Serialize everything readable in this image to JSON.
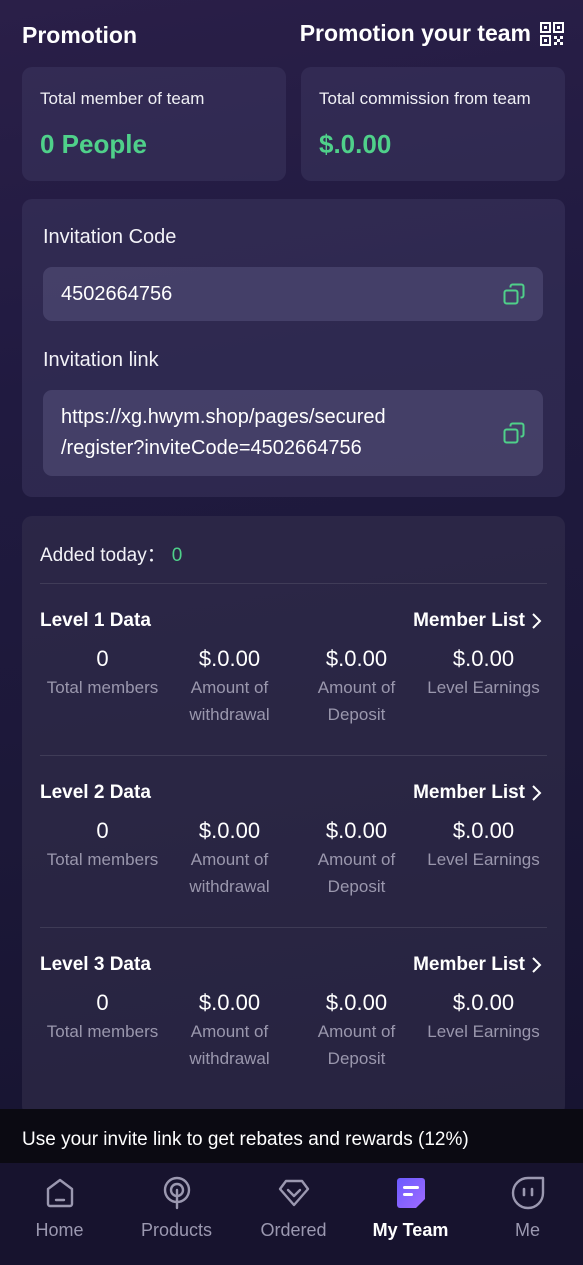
{
  "header": {
    "title": "Promotion",
    "promo_team_label": "Promotion your team",
    "promo_team_icon": "qr-code-icon"
  },
  "stats": {
    "members_label": "Total member of team",
    "members_value": "0 People",
    "commission_label": "Total commission from team",
    "commission_value": "$.0.00"
  },
  "invite": {
    "code_label": "Invitation Code",
    "code_value": "4502664756",
    "link_label": "Invitation link",
    "link_line1": "https://xg.hwym.shop/pages/secured",
    "link_line2": "/register?inviteCode=4502664756",
    "copy_icon": "copy-icon"
  },
  "team": {
    "added_label": "Added today：",
    "added_value": "0",
    "member_list_label": "Member List",
    "levels": [
      {
        "title": "Level 1 Data",
        "values": [
          "0",
          "$.0.00",
          "$.0.00",
          "$.0.00"
        ],
        "descs": [
          [
            "Total members"
          ],
          [
            "Amount of",
            "withdrawal"
          ],
          [
            "Amount of",
            "Deposit"
          ],
          [
            "Level Earnings"
          ]
        ]
      },
      {
        "title": "Level 2 Data",
        "values": [
          "0",
          "$.0.00",
          "$.0.00",
          "$.0.00"
        ],
        "descs": [
          [
            "Total members"
          ],
          [
            "Amount of",
            "withdrawal"
          ],
          [
            "Amount of",
            "Deposit"
          ],
          [
            "Level Earnings"
          ]
        ]
      },
      {
        "title": "Level 3 Data",
        "values": [
          "0",
          "$.0.00",
          "$.0.00",
          "$.0.00"
        ],
        "descs": [
          [
            "Total members"
          ],
          [
            "Amount of",
            "withdrawal"
          ],
          [
            "Amount of",
            "Deposit"
          ],
          [
            "Level Earnings"
          ]
        ]
      }
    ]
  },
  "banner": {
    "text": "Use your invite link to get rebates and rewards (12%)"
  },
  "tabbar": {
    "items": [
      {
        "label": "Home",
        "icon": "home-icon"
      },
      {
        "label": "Products",
        "icon": "products-icon"
      },
      {
        "label": "Ordered",
        "icon": "ordered-icon"
      },
      {
        "label": "My Team",
        "icon": "my-team-icon",
        "active": true
      },
      {
        "label": "Me",
        "icon": "me-icon"
      }
    ]
  },
  "colors": {
    "accent_green": "#4fd08a",
    "tab_active_gradient": [
      "#6b5bff",
      "#9b6bff"
    ]
  }
}
